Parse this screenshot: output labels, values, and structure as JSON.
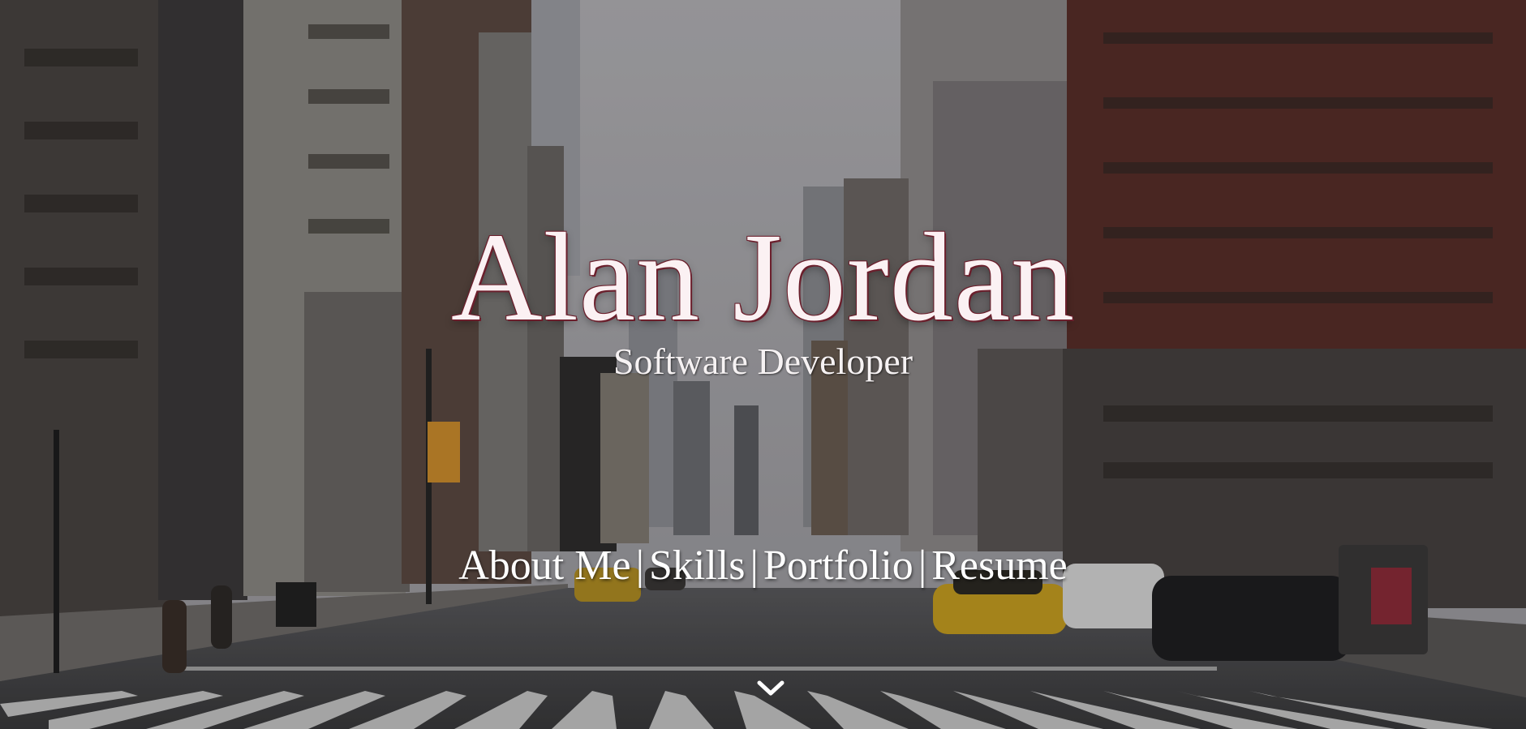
{
  "hero": {
    "name": "Alan Jordan",
    "tagline": "Software Developer",
    "colors": {
      "title_fill": "#fbf1f3",
      "title_outline": "#6b1f2c",
      "text": "#ffffff"
    }
  },
  "nav": {
    "separator": "|",
    "items": [
      {
        "label": "About Me"
      },
      {
        "label": "Skills"
      },
      {
        "label": "Portfolio"
      },
      {
        "label": "Resume"
      }
    ]
  },
  "scroll_indicator": {
    "icon": "chevron-down-icon"
  }
}
